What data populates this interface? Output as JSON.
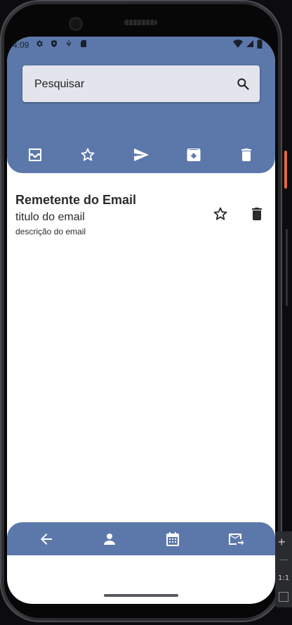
{
  "status_bar": {
    "time": "4:09",
    "left_icons": [
      "gear-icon",
      "shield-icon",
      "usb-icon",
      "sd-card-icon"
    ],
    "right_icons": [
      "wifi-icon",
      "cell-signal-icon",
      "battery-icon"
    ]
  },
  "search": {
    "placeholder": "Pesquisar",
    "value": ""
  },
  "tabs": [
    {
      "name": "inbox",
      "icon": "inbox-icon"
    },
    {
      "name": "starred",
      "icon": "star-outline-icon"
    },
    {
      "name": "sent",
      "icon": "send-icon"
    },
    {
      "name": "archive",
      "icon": "archive-icon"
    },
    {
      "name": "trash",
      "icon": "trash-icon"
    }
  ],
  "emails": [
    {
      "sender": "Remetente do Email",
      "subject": "titulo do email",
      "description": "descrição do email",
      "actions": [
        "star-outline-icon",
        "trash-icon"
      ]
    }
  ],
  "bottom_nav": [
    {
      "name": "back",
      "icon": "arrow-left-icon"
    },
    {
      "name": "profile",
      "icon": "person-icon"
    },
    {
      "name": "calendar",
      "icon": "calendar-icon"
    },
    {
      "name": "forward-mail",
      "icon": "mail-forward-icon"
    }
  ],
  "emulator_toolbar": {
    "zoom_in": "+",
    "ratio": "1:1"
  },
  "colors": {
    "primary": "#5c78ab",
    "search_bg": "#e4e4ec",
    "text": "#2b2b2f",
    "background": "#ffffff"
  }
}
